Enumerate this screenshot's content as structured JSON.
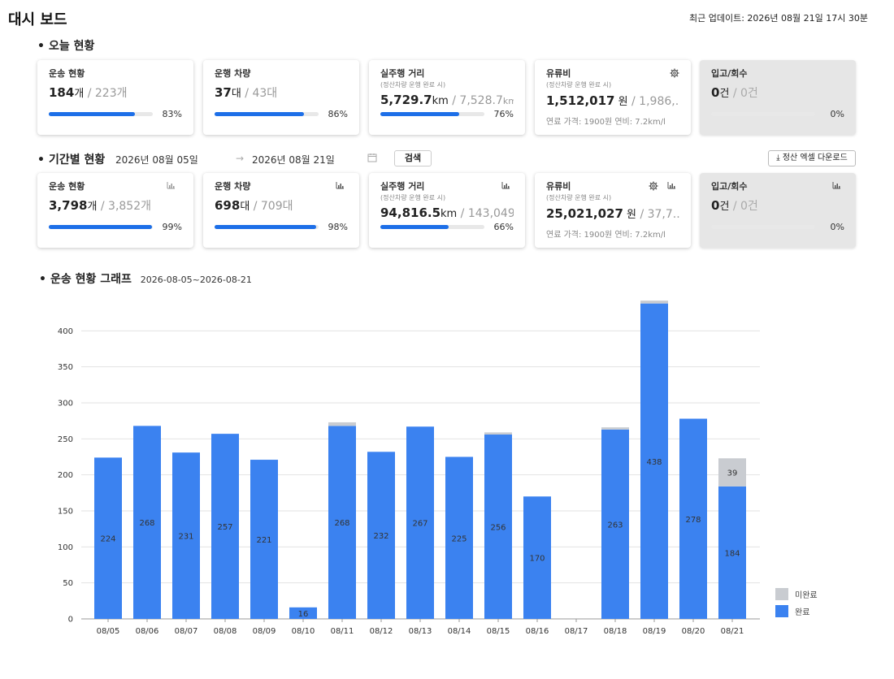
{
  "header": {
    "title": "대시 보드",
    "last_update": "최근 업데이트: 2026년 08월 21일 17시 30분"
  },
  "today": {
    "section_title": "오늘 현황",
    "cards": [
      {
        "title": "운송 현황",
        "value": "184",
        "unit": "개",
        "total": " / 223개",
        "percent_label": "83%",
        "percent": 0.83
      },
      {
        "title": "운행 차량",
        "value": "37",
        "unit": "대",
        "total": " / 43대",
        "percent_label": "86%",
        "percent": 0.86
      },
      {
        "title": "실주행 거리",
        "sub": "(정산차량 운행 완료 시)",
        "value": "5,729.7",
        "unit": "km",
        "total": " / 7,528.7",
        "total_unit": "km",
        "percent_label": "76%",
        "percent": 0.76
      },
      {
        "title": "유류비",
        "sub": "(정산차량 운행 완료 시)",
        "value": "1,512,017",
        "unit": " 원",
        "total": " / 1,986,...",
        "foot": "연료 가격: 1900원 연비: 7.2km/l"
      },
      {
        "title": "입고/회수",
        "value": "0",
        "unit": "건",
        "total": " / 0건",
        "percent_label": "0%",
        "percent": 0
      }
    ]
  },
  "period": {
    "section_title": "기간별 현황",
    "start_date": "2026년 08월 05일",
    "arrow": "→",
    "end_date": "2026년 08월 21일",
    "search_label": "검색",
    "download_label": "⤓ 정산 엑셀 다운로드",
    "cards": [
      {
        "title": "운송 현황",
        "value": "3,798",
        "unit": "개",
        "total": " / 3,852개",
        "percent_label": "99%",
        "percent": 0.99
      },
      {
        "title": "운행 차량",
        "value": "698",
        "unit": "대",
        "total": " / 709대",
        "percent_label": "98%",
        "percent": 0.98
      },
      {
        "title": "실주행 거리",
        "sub": "(정산차량 운행 완료 시)",
        "value": "94,816.5",
        "unit": "km",
        "total": " / 143,049...",
        "percent_label": "66%",
        "percent": 0.66
      },
      {
        "title": "유류비",
        "sub": "(정산차량 운행 완료 시)",
        "value": "25,021,027",
        "unit": " 원",
        "total": " / 37,7...",
        "foot": "연료 가격: 1900원 연비: 7.2km/l"
      },
      {
        "title": "입고/회수",
        "value": "0",
        "unit": "건",
        "total": " / 0건",
        "percent_label": "0%",
        "percent": 0
      }
    ]
  },
  "chart_section": {
    "title": "운송 현황 그래프",
    "range": "2026-08-05~2026-08-21"
  },
  "colors": {
    "accent": "#1d6fe8",
    "complete": "#3b82f0",
    "incomplete": "#c9ccd1"
  },
  "chart_data": {
    "type": "bar",
    "stacked": true,
    "categories": [
      "08/05",
      "08/06",
      "08/07",
      "08/08",
      "08/09",
      "08/10",
      "08/11",
      "08/12",
      "08/13",
      "08/14",
      "08/15",
      "08/16",
      "08/17",
      "08/18",
      "08/19",
      "08/20",
      "08/21"
    ],
    "series": [
      {
        "name": "완료",
        "values": [
          224,
          268,
          231,
          257,
          221,
          16,
          268,
          232,
          267,
          225,
          256,
          170,
          0,
          263,
          438,
          278,
          184
        ]
      },
      {
        "name": "미완료",
        "values": [
          0,
          0,
          0,
          0,
          0,
          0,
          5,
          0,
          0,
          0,
          3,
          0,
          0,
          3,
          4,
          0,
          39
        ]
      }
    ],
    "value_labels": [
      "224",
      "268",
      "231",
      "257",
      "221",
      "16",
      "268",
      "232",
      "267",
      "225",
      "256",
      "170",
      "",
      "263",
      "438",
      "278",
      "184"
    ],
    "incomplete_labels": [
      "",
      "",
      "",
      "",
      "",
      "",
      "",
      "",
      "",
      "",
      "",
      "",
      "",
      "",
      "",
      "",
      "39"
    ],
    "yticks": [
      "0",
      "50",
      "100",
      "150",
      "200",
      "250",
      "300",
      "350",
      "400"
    ],
    "ylim": [
      0,
      450
    ],
    "grid": true,
    "legend_position": "bottom-right"
  }
}
